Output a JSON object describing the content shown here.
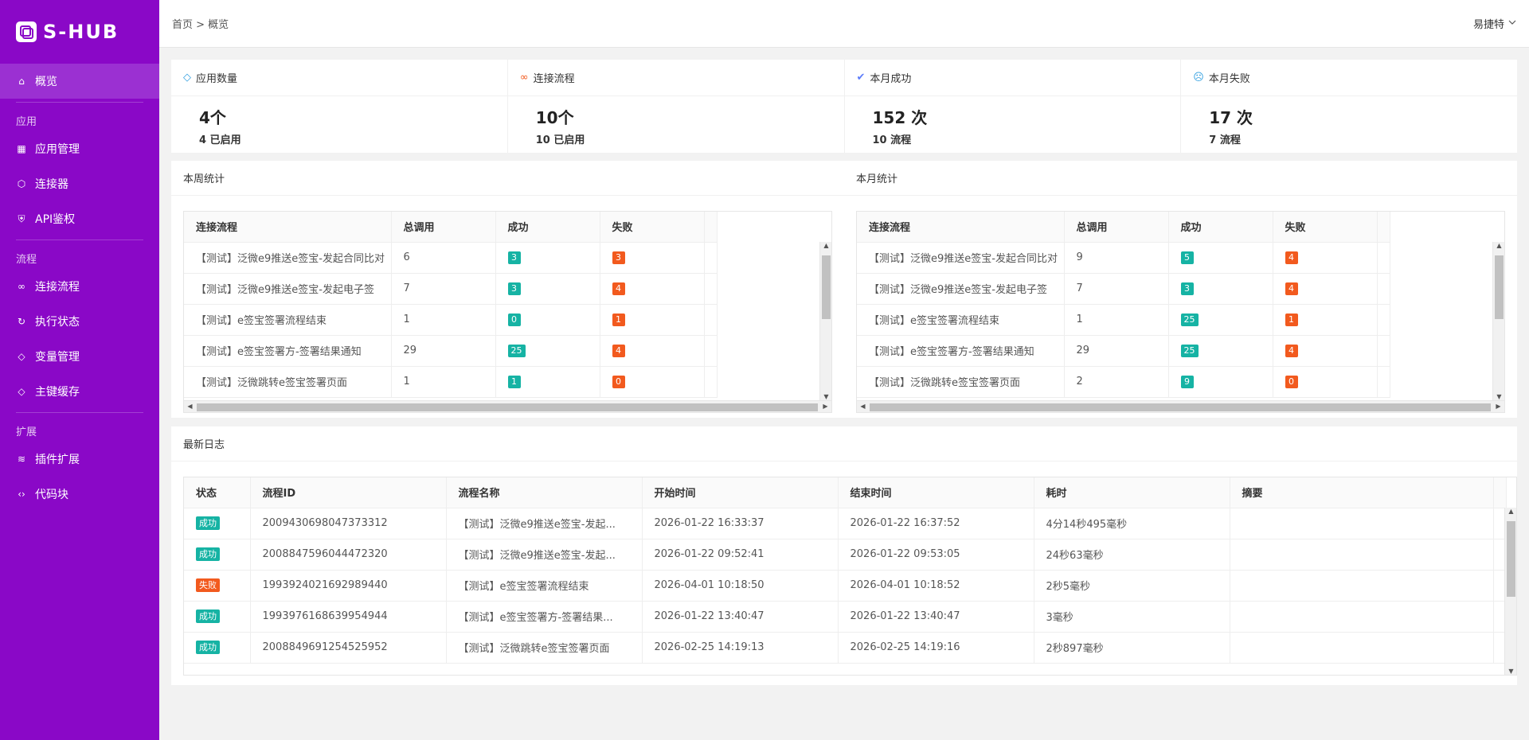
{
  "app": {
    "logo_text": "S-HUB"
  },
  "sidebar": {
    "items": [
      {
        "label": "概览",
        "icon": "home-icon"
      },
      {
        "group": "应用"
      },
      {
        "label": "应用管理",
        "icon": "grid-icon"
      },
      {
        "label": "连接器",
        "icon": "cube-icon"
      },
      {
        "label": "API鉴权",
        "icon": "shield-icon"
      },
      {
        "group": "流程"
      },
      {
        "label": "连接流程",
        "icon": "link-icon"
      },
      {
        "label": "执行状态",
        "icon": "refresh-icon"
      },
      {
        "label": "变量管理",
        "icon": "tag-icon"
      },
      {
        "label": "主键缓存",
        "icon": "tag-icon"
      },
      {
        "group": "扩展"
      },
      {
        "label": "插件扩展",
        "icon": "layers-icon"
      },
      {
        "label": "代码块",
        "icon": "code-icon"
      }
    ]
  },
  "header": {
    "breadcrumb": "首页 > 概览",
    "user": "易捷特"
  },
  "stats": [
    {
      "title": "应用数量",
      "value": "4个",
      "sub": "4 已启用",
      "icon": "diamond-icon",
      "color": "#33a0e0"
    },
    {
      "title": "连接流程",
      "value": "10个",
      "sub": "10 已启用",
      "icon": "link-icon",
      "color": "#f25a1e"
    },
    {
      "title": "本月成功",
      "value": "152 次",
      "sub": "10 流程",
      "icon": "check-circle-icon",
      "color": "#5c7cfa"
    },
    {
      "title": "本月失败",
      "value": "17 次",
      "sub": "7 流程",
      "icon": "sad-face-icon",
      "color": "#33a0e0"
    }
  ],
  "week": {
    "title": "本周统计",
    "headers": [
      "连接流程",
      "总调用",
      "成功",
      "失败"
    ],
    "rows": [
      {
        "name": "【测试】泛微e9推送e签宝-发起合同比对",
        "total": "6",
        "success": "3",
        "fail": "3"
      },
      {
        "name": "【测试】泛微e9推送e签宝-发起电子签",
        "total": "7",
        "success": "3",
        "fail": "4"
      },
      {
        "name": "【测试】e签宝签署流程结束",
        "total": "1",
        "success": "0",
        "fail": "1"
      },
      {
        "name": "【测试】e签宝签署方-签署结果通知",
        "total": "29",
        "success": "25",
        "fail": "4"
      },
      {
        "name": "【测试】泛微跳转e签宝签署页面",
        "total": "1",
        "success": "1",
        "fail": "0"
      }
    ]
  },
  "month": {
    "title": "本月统计",
    "headers": [
      "连接流程",
      "总调用",
      "成功",
      "失败"
    ],
    "rows": [
      {
        "name": "【测试】泛微e9推送e签宝-发起合同比对",
        "total": "9",
        "success": "5",
        "fail": "4"
      },
      {
        "name": "【测试】泛微e9推送e签宝-发起电子签",
        "total": "7",
        "success": "3",
        "fail": "4"
      },
      {
        "name": "【测试】e签宝签署流程结束",
        "total": "1",
        "success": "25",
        "fail": "1"
      },
      {
        "name": "【测试】e签宝签署方-签署结果通知",
        "total": "29",
        "success": "25",
        "fail": "4"
      },
      {
        "name": "【测试】泛微跳转e签宝签署页面",
        "total": "2",
        "success": "9",
        "fail": "0"
      }
    ]
  },
  "logs": {
    "title": "最新日志",
    "headers": [
      "状态",
      "流程ID",
      "流程名称",
      "开始时间",
      "结束时间",
      "耗时",
      "摘要"
    ],
    "rows": [
      {
        "status": "成功",
        "id": "2009430698047373312",
        "name": "【测试】泛微e9推送e签宝-发起...",
        "start": "2026-01-22 16:33:37",
        "end": "2026-01-22 16:37:52",
        "cost": "4分14秒495毫秒",
        "summary": ""
      },
      {
        "status": "成功",
        "id": "2008847596044472320",
        "name": "【测试】泛微e9推送e签宝-发起...",
        "start": "2026-01-22 09:52:41",
        "end": "2026-01-22 09:53:05",
        "cost": "24秒63毫秒",
        "summary": ""
      },
      {
        "status": "失败",
        "id": "1993924021692989440",
        "name": "【测试】e签宝签署流程结束",
        "start": "2026-04-01 10:18:50",
        "end": "2026-04-01 10:18:52",
        "cost": "2秒5毫秒",
        "summary": ""
      },
      {
        "status": "成功",
        "id": "1993976168639954944",
        "name": "【测试】e签宝签署方-签署结果...",
        "start": "2026-01-22 13:40:47",
        "end": "2026-01-22 13:40:47",
        "cost": "3毫秒",
        "summary": ""
      },
      {
        "status": "成功",
        "id": "2008849691254525952",
        "name": "【测试】泛微跳转e签宝签署页面",
        "start": "2026-02-25 14:19:13",
        "end": "2026-02-25 14:19:16",
        "cost": "2秒897毫秒",
        "summary": ""
      }
    ]
  },
  "colors": {
    "sidebar": "#8a08c7",
    "active": "#9b30d2",
    "success": "#16b3a4",
    "fail": "#f25a1e"
  }
}
